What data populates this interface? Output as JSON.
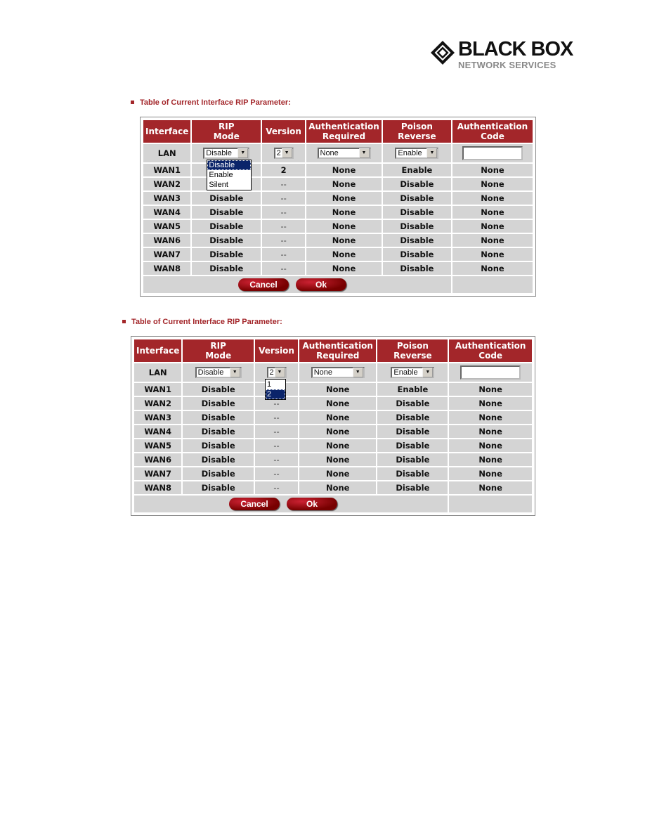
{
  "logo": {
    "line1": "BLACK BOX",
    "line2": "NETWORK SERVICES"
  },
  "accent": "#a3262a",
  "headers": [
    "Interface",
    "RIP\nMode",
    "Version",
    "Authentication\nRequired",
    "Poison\nReverse",
    "Authentication\nCode"
  ],
  "tables": [
    {
      "title": "Table of Current Interface RIP Parameter:",
      "lan": {
        "name": "LAN",
        "rip_mode": "Disable",
        "version": "2",
        "auth": "None",
        "poison": "Enable",
        "code": ""
      },
      "open_dropdown": {
        "column": "rip_mode",
        "options": [
          "Disable",
          "Enable",
          "Silent"
        ],
        "highlighted": "Disable"
      },
      "rows": [
        {
          "name": "WAN1",
          "rip_mode": "",
          "version": "2",
          "auth": "None",
          "poison": "Enable",
          "code": "None"
        },
        {
          "name": "WAN2",
          "rip_mode": "",
          "version": "--",
          "auth": "None",
          "poison": "Disable",
          "code": "None"
        },
        {
          "name": "WAN3",
          "rip_mode": "Disable",
          "version": "--",
          "auth": "None",
          "poison": "Disable",
          "code": "None"
        },
        {
          "name": "WAN4",
          "rip_mode": "Disable",
          "version": "--",
          "auth": "None",
          "poison": "Disable",
          "code": "None"
        },
        {
          "name": "WAN5",
          "rip_mode": "Disable",
          "version": "--",
          "auth": "None",
          "poison": "Disable",
          "code": "None"
        },
        {
          "name": "WAN6",
          "rip_mode": "Disable",
          "version": "--",
          "auth": "None",
          "poison": "Disable",
          "code": "None"
        },
        {
          "name": "WAN7",
          "rip_mode": "Disable",
          "version": "--",
          "auth": "None",
          "poison": "Disable",
          "code": "None"
        },
        {
          "name": "WAN8",
          "rip_mode": "Disable",
          "version": "--",
          "auth": "None",
          "poison": "Disable",
          "code": "None"
        }
      ],
      "cancel": "Cancel",
      "ok": "Ok"
    },
    {
      "title": "Table of Current Interface RIP Parameter:",
      "lan": {
        "name": "LAN",
        "rip_mode": "Disable",
        "version": "2",
        "auth": "None",
        "poison": "Enable",
        "code": ""
      },
      "open_dropdown": {
        "column": "version",
        "options": [
          "1",
          "2"
        ],
        "highlighted": "2"
      },
      "rows": [
        {
          "name": "WAN1",
          "rip_mode": "Disable",
          "version": "",
          "auth": "None",
          "poison": "Enable",
          "code": "None"
        },
        {
          "name": "WAN2",
          "rip_mode": "Disable",
          "version": "--",
          "auth": "None",
          "poison": "Disable",
          "code": "None"
        },
        {
          "name": "WAN3",
          "rip_mode": "Disable",
          "version": "--",
          "auth": "None",
          "poison": "Disable",
          "code": "None"
        },
        {
          "name": "WAN4",
          "rip_mode": "Disable",
          "version": "--",
          "auth": "None",
          "poison": "Disable",
          "code": "None"
        },
        {
          "name": "WAN5",
          "rip_mode": "Disable",
          "version": "--",
          "auth": "None",
          "poison": "Disable",
          "code": "None"
        },
        {
          "name": "WAN6",
          "rip_mode": "Disable",
          "version": "--",
          "auth": "None",
          "poison": "Disable",
          "code": "None"
        },
        {
          "name": "WAN7",
          "rip_mode": "Disable",
          "version": "--",
          "auth": "None",
          "poison": "Disable",
          "code": "None"
        },
        {
          "name": "WAN8",
          "rip_mode": "Disable",
          "version": "--",
          "auth": "None",
          "poison": "Disable",
          "code": "None"
        }
      ],
      "cancel": "Cancel",
      "ok": "Ok"
    }
  ]
}
